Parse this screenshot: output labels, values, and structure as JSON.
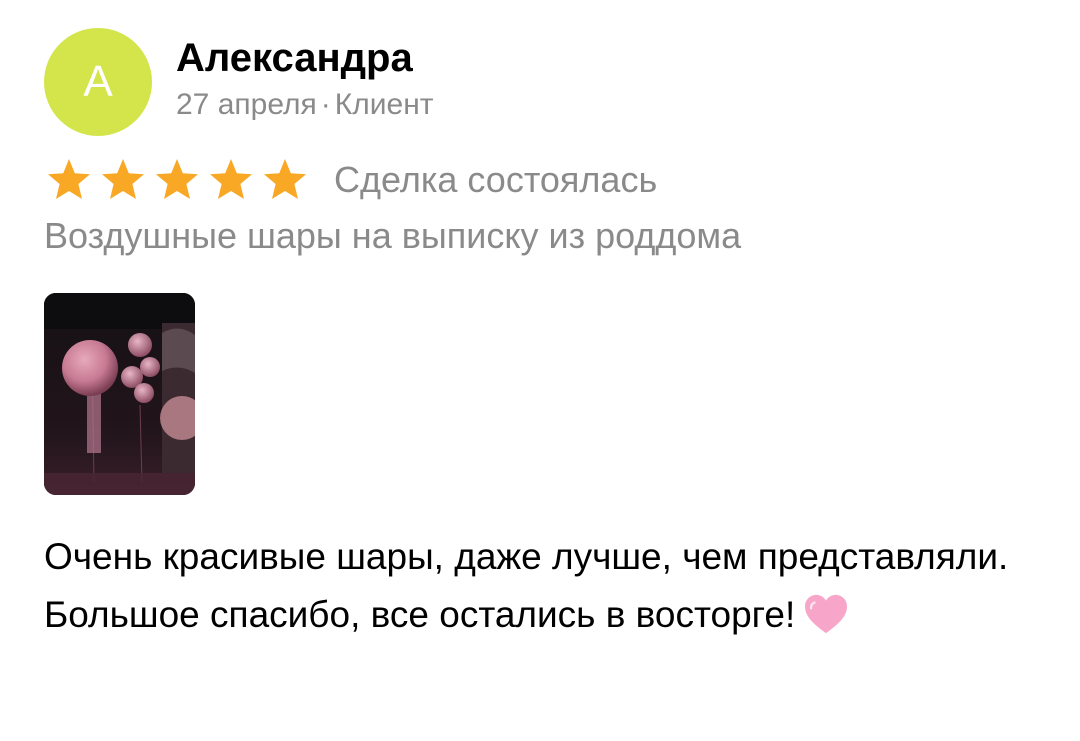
{
  "review": {
    "avatar_letter": "A",
    "author_name": "Александра",
    "date": "27 апреля",
    "separator": "·",
    "role": "Клиент",
    "rating": 5,
    "rating_max": 5,
    "deal_status": "Сделка состоялась",
    "service": "Воздушные шары на выписку из роддома",
    "photo_icon": "balloons-photo",
    "text": "Очень красивые шары, даже лучше, чем представляли. Большое спасибо, все остались в восторге!",
    "emoji_icon": "pink-heart-icon"
  },
  "colors": {
    "avatar_bg": "#d3e54a",
    "star": "#f9a825",
    "muted_text": "#8a8a8a",
    "heart": "#f7a6c9"
  }
}
